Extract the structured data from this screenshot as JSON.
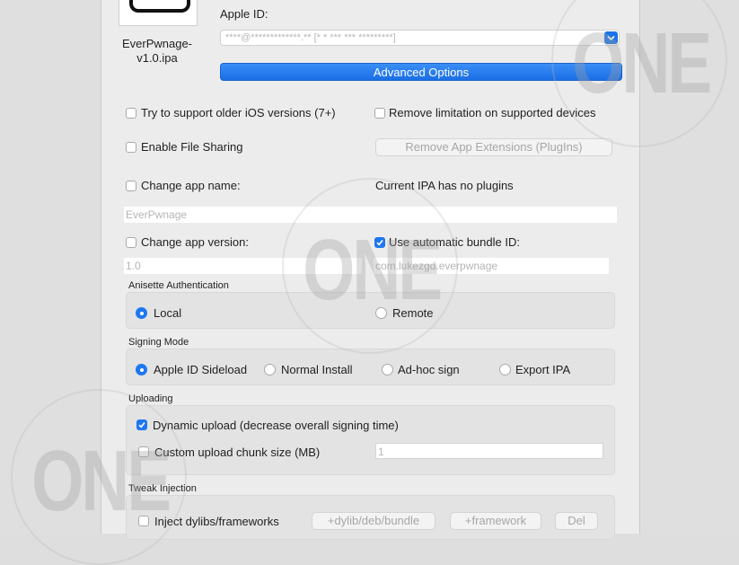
{
  "app": {
    "name": "EverPwnage-\nv1.0.ipa"
  },
  "apple_id": {
    "label": "Apple ID:",
    "value": "****@*************.** [* * *** *** *********]"
  },
  "advanced_button": "Advanced Options",
  "options": {
    "older_ios": "Try to support older iOS versions (7+)",
    "remove_limitation": "Remove limitation on supported devices",
    "file_sharing": "Enable File Sharing",
    "remove_extensions": "Remove App Extensions (PlugIns)",
    "change_name": "Change app name:",
    "plugins_status": "Current IPA has no plugins",
    "name_placeholder": "EverPwnage",
    "change_version": "Change app version:",
    "auto_bundle": "Use automatic bundle ID:",
    "version_placeholder": "1.0",
    "bundle_placeholder": "com.lukezgd.everpwnage"
  },
  "anisette": {
    "title": "Anisette Authentication",
    "local": "Local",
    "remote": "Remote"
  },
  "signing": {
    "title": "Signing Mode",
    "sideload": "Apple ID Sideload",
    "normal": "Normal Install",
    "adhoc": "Ad-hoc sign",
    "export": "Export IPA"
  },
  "uploading": {
    "title": "Uploading",
    "dynamic": "Dynamic upload (decrease overall signing time)",
    "custom_chunk": "Custom upload chunk size (MB)",
    "chunk_placeholder": "1"
  },
  "tweak": {
    "title": "Tweak Injection",
    "inject": "Inject dylibs/frameworks",
    "add_dylib": "+dylib/deb/bundle",
    "add_framework": "+framework",
    "delete": "Del"
  },
  "watermark": "ONE",
  "colors": {
    "accent": "#1f77f0",
    "panel": "#ececec",
    "group": "#e3e3e3"
  }
}
